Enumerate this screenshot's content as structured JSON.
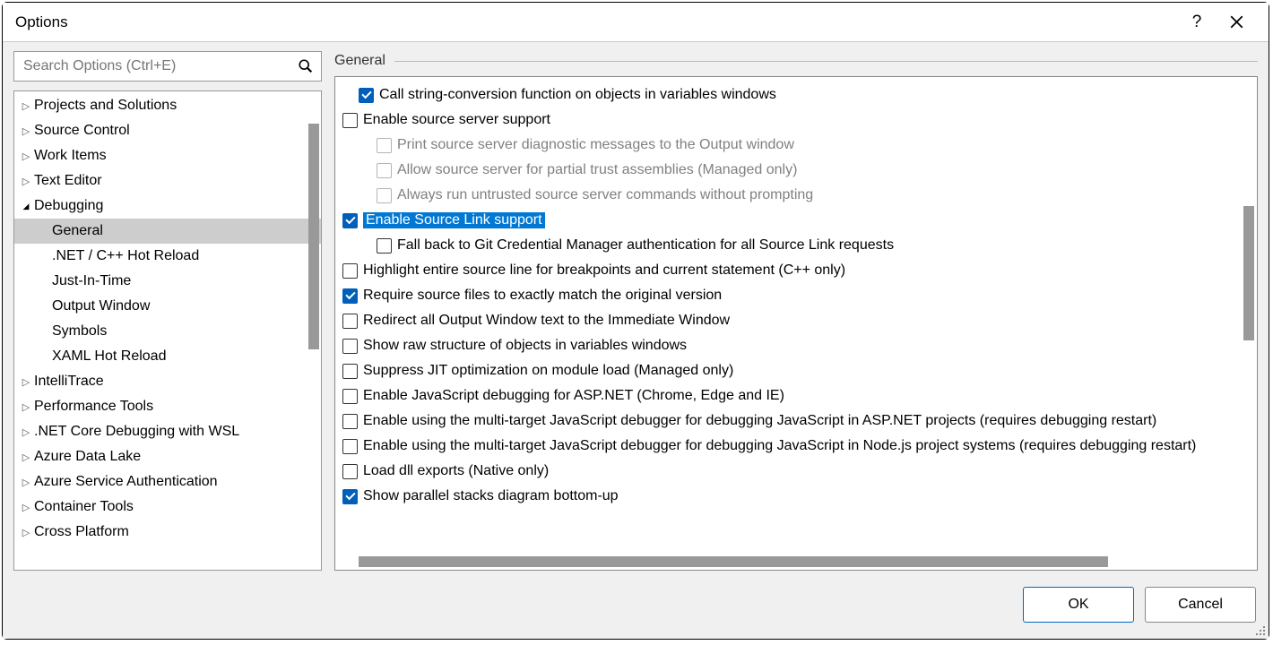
{
  "dialog": {
    "title": "Options",
    "section_label": "General"
  },
  "search": {
    "placeholder": "Search Options (Ctrl+E)"
  },
  "tree": [
    {
      "label": "Projects and Solutions",
      "expanded": false,
      "child": false
    },
    {
      "label": "Source Control",
      "expanded": false,
      "child": false
    },
    {
      "label": "Work Items",
      "expanded": false,
      "child": false
    },
    {
      "label": "Text Editor",
      "expanded": false,
      "child": false
    },
    {
      "label": "Debugging",
      "expanded": true,
      "child": false
    },
    {
      "label": "General",
      "expanded": null,
      "child": true,
      "selected": true
    },
    {
      "label": ".NET / C++ Hot Reload",
      "expanded": null,
      "child": true
    },
    {
      "label": "Just-In-Time",
      "expanded": null,
      "child": true
    },
    {
      "label": "Output Window",
      "expanded": null,
      "child": true
    },
    {
      "label": "Symbols",
      "expanded": null,
      "child": true
    },
    {
      "label": "XAML Hot Reload",
      "expanded": null,
      "child": true
    },
    {
      "label": "IntelliTrace",
      "expanded": false,
      "child": false
    },
    {
      "label": "Performance Tools",
      "expanded": false,
      "child": false
    },
    {
      "label": ".NET Core Debugging with WSL",
      "expanded": false,
      "child": false
    },
    {
      "label": "Azure Data Lake",
      "expanded": false,
      "child": false
    },
    {
      "label": "Azure Service Authentication",
      "expanded": false,
      "child": false
    },
    {
      "label": "Container Tools",
      "expanded": false,
      "child": false
    },
    {
      "label": "Cross Platform",
      "expanded": false,
      "child": false
    }
  ],
  "options": [
    {
      "label": "Call string-conversion function on objects in variables windows",
      "checked": true,
      "indent": 1,
      "enabled": true
    },
    {
      "label": "Enable source server support",
      "checked": false,
      "indent": 0,
      "enabled": true
    },
    {
      "label": "Print source server diagnostic messages to the Output window",
      "checked": false,
      "indent": 2,
      "enabled": false
    },
    {
      "label": "Allow source server for partial trust assemblies (Managed only)",
      "checked": false,
      "indent": 2,
      "enabled": false
    },
    {
      "label": "Always run untrusted source server commands without prompting",
      "checked": false,
      "indent": 2,
      "enabled": false
    },
    {
      "label": "Enable Source Link support",
      "checked": true,
      "indent": 0,
      "enabled": true,
      "highlighted": true
    },
    {
      "label": "Fall back to Git Credential Manager authentication for all Source Link requests",
      "checked": false,
      "indent": 2,
      "enabled": true
    },
    {
      "label": "Highlight entire source line for breakpoints and current statement (C++ only)",
      "checked": false,
      "indent": 0,
      "enabled": true
    },
    {
      "label": "Require source files to exactly match the original version",
      "checked": true,
      "indent": 0,
      "enabled": true
    },
    {
      "label": "Redirect all Output Window text to the Immediate Window",
      "checked": false,
      "indent": 0,
      "enabled": true
    },
    {
      "label": "Show raw structure of objects in variables windows",
      "checked": false,
      "indent": 0,
      "enabled": true
    },
    {
      "label": "Suppress JIT optimization on module load (Managed only)",
      "checked": false,
      "indent": 0,
      "enabled": true
    },
    {
      "label": "Enable JavaScript debugging for ASP.NET (Chrome, Edge and IE)",
      "checked": false,
      "indent": 0,
      "enabled": true
    },
    {
      "label": "Enable using the multi-target JavaScript debugger for debugging JavaScript in ASP.NET projects (requires debugging restart)",
      "checked": false,
      "indent": 0,
      "enabled": true
    },
    {
      "label": "Enable using the multi-target JavaScript debugger for debugging JavaScript in Node.js project systems (requires debugging restart)",
      "checked": false,
      "indent": 0,
      "enabled": true
    },
    {
      "label": "Load dll exports (Native only)",
      "checked": false,
      "indent": 0,
      "enabled": true
    },
    {
      "label": "Show parallel stacks diagram bottom-up",
      "checked": true,
      "indent": 0,
      "enabled": true
    }
  ],
  "buttons": {
    "ok": "OK",
    "cancel": "Cancel"
  }
}
